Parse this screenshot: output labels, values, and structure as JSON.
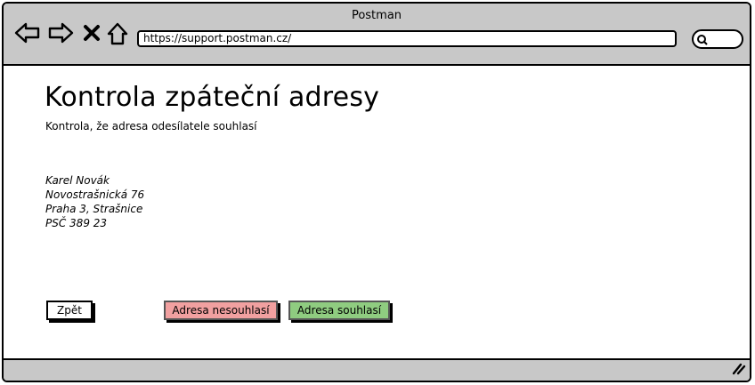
{
  "window": {
    "title": "Postman"
  },
  "browser": {
    "url": "https://support.postman.cz/",
    "icons": [
      "back-arrow-icon",
      "forward-arrow-icon",
      "close-icon",
      "home-icon",
      "search-icon",
      "resize-grip-icon"
    ]
  },
  "page": {
    "title": "Kontrola zpáteční adresy",
    "subtitle": "Kontrola, že adresa odesílatele souhlasí",
    "address": {
      "name": "Karel Novák",
      "street": "Novostrašnická 76",
      "city": "Praha 3, Strašnice",
      "zip": "PSČ 389 23"
    }
  },
  "buttons": {
    "back": "Zpět",
    "reject": "Adresa nesouhlasí",
    "accept": "Adresa souhlasí"
  },
  "colors": {
    "chrome": "#c8c8c8",
    "reject": "#f1a0a0",
    "accept": "#8fcc80"
  }
}
